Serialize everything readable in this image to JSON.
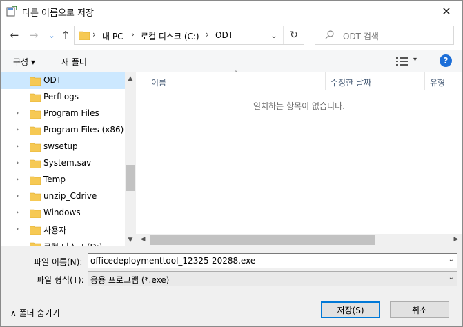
{
  "window": {
    "title": "다른 이름으로 저장",
    "close_glyph": "✕"
  },
  "nav": {
    "back_glyph": "←",
    "forward_glyph": "→",
    "recent_glyph": "⌄",
    "up_glyph": "↑",
    "address": [
      "내 PC",
      "로컬 디스크 (C:)",
      "ODT"
    ],
    "address_chevron": "›",
    "dropdown_glyph": "⌄",
    "refresh_glyph": "↻",
    "search_placeholder": "ODT 검색"
  },
  "toolbar": {
    "organize_label": "구성 ▾",
    "new_folder_label": "새 폴더",
    "help_glyph": "?",
    "view_dropdown_glyph": "▾"
  },
  "tree": {
    "items": [
      {
        "label": "ODT",
        "selected": true,
        "chevron": ""
      },
      {
        "label": "PerfLogs",
        "chevron": ""
      },
      {
        "label": "Program Files",
        "chevron": "›"
      },
      {
        "label": "Program Files (x86)",
        "chevron": "›"
      },
      {
        "label": "swsetup",
        "chevron": "›"
      },
      {
        "label": "System.sav",
        "chevron": "›"
      },
      {
        "label": "Temp",
        "chevron": "›"
      },
      {
        "label": "unzip_Cdrive",
        "chevron": "›"
      },
      {
        "label": "Windows",
        "chevron": "›"
      },
      {
        "label": "사용자",
        "chevron": "›"
      },
      {
        "label": "로컬 디스크 (D:)",
        "chevron": "⌄"
      }
    ]
  },
  "list": {
    "columns": [
      "이름",
      "수정한 날짜",
      "유형"
    ],
    "sort_indicator": "^",
    "empty_message": "일치하는 항목이 없습니다."
  },
  "form": {
    "filename_label": "파일 이름(N):",
    "filename_value": "officedeploymenttool_12325-20288.exe",
    "filetype_label": "파일 형식(T):",
    "filetype_value": "응용 프로그램 (*.exe)",
    "dropdown_glyph": "⌄"
  },
  "footer": {
    "hide_folders_label": "∧  폴더 숨기기",
    "save_label": "저장(S)",
    "cancel_label": "취소"
  },
  "colors": {
    "accent": "#0078d7",
    "selected_bg": "#cce8ff",
    "folder": "#f6c954"
  }
}
